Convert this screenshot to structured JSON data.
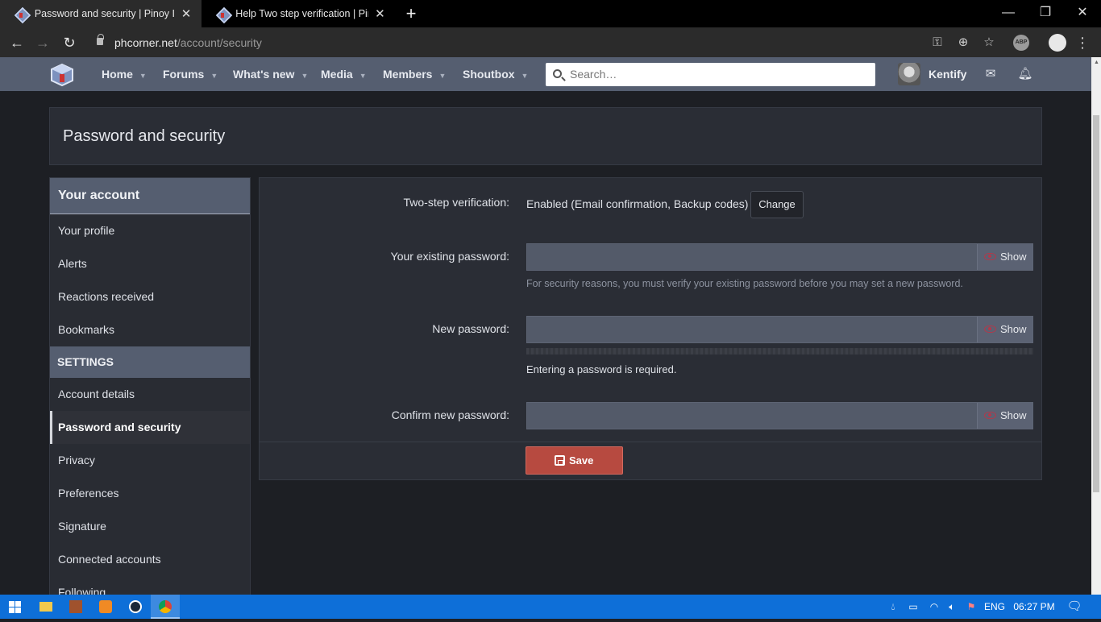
{
  "browser": {
    "tabs": [
      {
        "title": "Password and security | Pinoy Int",
        "active": true
      },
      {
        "title": "Help Two step verification | Pinoy",
        "active": false
      }
    ],
    "url_host": "phcorner.net",
    "url_path": "/account/security",
    "window_controls": {
      "minimize": "—",
      "restore": "❐",
      "close": "✕"
    },
    "icons": {
      "back": "arrow-left",
      "forward": "arrow-right",
      "reload": "reload",
      "key": "key",
      "add": "add-circle",
      "star": "star",
      "abp": "ABP",
      "ext": "extension"
    }
  },
  "site_nav": {
    "items": [
      {
        "label": "Home"
      },
      {
        "label": "Forums"
      },
      {
        "label": "What's new"
      },
      {
        "label": "Media"
      },
      {
        "label": "Members"
      },
      {
        "label": "Shoutbox"
      }
    ],
    "search_placeholder": "Search…",
    "username": "Kentify"
  },
  "page": {
    "title": "Password and security"
  },
  "sidebar": {
    "heading": "Your account",
    "account_items": [
      {
        "label": "Your profile"
      },
      {
        "label": "Alerts"
      },
      {
        "label": "Reactions received"
      },
      {
        "label": "Bookmarks"
      }
    ],
    "settings_heading": "SETTINGS",
    "settings_items": [
      {
        "label": "Account details",
        "active": false
      },
      {
        "label": "Password and security",
        "active": true
      },
      {
        "label": "Privacy",
        "active": false
      },
      {
        "label": "Preferences",
        "active": false
      },
      {
        "label": "Signature",
        "active": false
      },
      {
        "label": "Connected accounts",
        "active": false
      },
      {
        "label": "Following",
        "active": false
      }
    ]
  },
  "form": {
    "two_step_label": "Two-step verification:",
    "two_step_value": "Enabled (Email confirmation, Backup codes)",
    "change_button": "Change",
    "existing_label": "Your existing password:",
    "existing_hint": "For security reasons, you must verify your existing password before you may set a new password.",
    "new_label": "New password:",
    "required_msg": "Entering a password is required.",
    "confirm_label": "Confirm new password:",
    "show_label": "Show",
    "save_button": "Save"
  },
  "taskbar": {
    "language": "ENG",
    "time": "06:27 PM"
  }
}
